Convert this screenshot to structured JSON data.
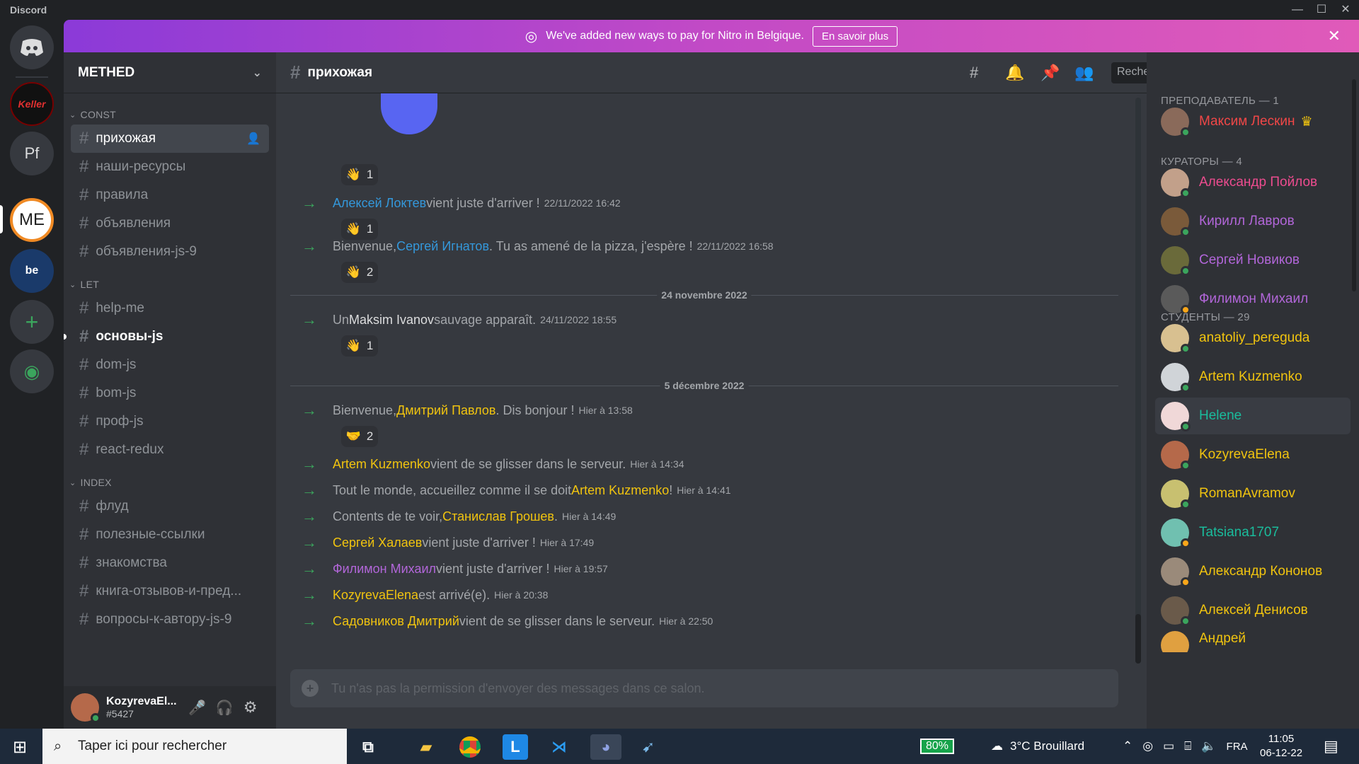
{
  "titlebar": {
    "app": "Discord",
    "min": "—",
    "max": "☐",
    "close": "✕"
  },
  "guilds": [
    {
      "name": "discord-home",
      "label": "",
      "color": "#36393f"
    },
    {
      "name": "keller",
      "label": "Keller",
      "color": "#111111"
    },
    {
      "name": "pf",
      "label": "Pf",
      "color": "#36393f"
    },
    {
      "name": "me",
      "label": "ME",
      "color": "#ffffff"
    },
    {
      "name": "be-charleroi",
      "label": "be",
      "color": "#1a3a6a"
    }
  ],
  "banner": {
    "text": "We've added new ways to pay for Nitro in Belgique.",
    "button": "En savoir plus"
  },
  "server": {
    "name": "METHED"
  },
  "categories": [
    {
      "name": "CONST",
      "channels": [
        "прихожая",
        "наши-ресурсы",
        "правила",
        "объявления",
        "объявления-js-9"
      ]
    },
    {
      "name": "LET",
      "channels": [
        "help-me",
        "основы-js",
        "dom-js",
        "bom-js",
        "проф-js",
        "react-redux"
      ]
    },
    {
      "name": "INDEX",
      "channels": [
        "флуд",
        "полезные-ссылки",
        "знакомства",
        "книга-отзывов-и-пред...",
        "вопросы-к-автору-js-9"
      ]
    }
  ],
  "user": {
    "name": "KozyrevaEl...",
    "tag": "#5427"
  },
  "channel": {
    "title": "прихожая"
  },
  "search": {
    "placeholder": "Rechercher"
  },
  "messages": {
    "m1": {
      "pre": "",
      "name": "Алексей Локтев",
      "post": " vient juste d'arriver !",
      "ts": "22/11/2022 16:42",
      "reaction": "1"
    },
    "m2": {
      "pre": "Bienvenue, ",
      "name": "Сергей Игнатов",
      "post": ". Tu as amené de la pizza, j'espère !",
      "ts": "22/11/2022 16:58",
      "reaction": "2"
    },
    "d1": "24 novembre 2022",
    "m3": {
      "pre": "Un ",
      "name": "Maksim Ivanov",
      "post": " sauvage apparaît.",
      "ts": "24/11/2022 18:55",
      "reaction": "1"
    },
    "d2": "5 décembre 2022",
    "m4": {
      "pre": "Bienvenue, ",
      "name": "Дмитрий Павлов",
      "post": ". Dis bonjour !",
      "ts": "Hier à 13:58",
      "reaction": "2"
    },
    "m5": {
      "pre": "",
      "name": "Artem Kuzmenko",
      "post": " vient de se glisser dans le serveur.",
      "ts": "Hier à 14:34"
    },
    "m6": {
      "pre": "Tout le monde, accueillez comme il se doit ",
      "name": "Artem Kuzmenko",
      "post": " !",
      "ts": "Hier à 14:41"
    },
    "m7": {
      "pre": "Contents de te voir, ",
      "name": "Станислав Грошев",
      "post": ".",
      "ts": "Hier à 14:49"
    },
    "m8": {
      "pre": "",
      "name": "Сергей Халаев",
      "post": " vient juste d'arriver !",
      "ts": "Hier à 17:49"
    },
    "m9": {
      "pre": "",
      "name": "Филимон Михаил",
      "post": " vient juste d'arriver !",
      "ts": "Hier à 19:57"
    },
    "m10": {
      "pre": "",
      "name": "KozyrevaElena",
      "post": " est arrivé(e).",
      "ts": "Hier à 20:38"
    },
    "m11": {
      "pre": "",
      "name": "Садовников Дмитрий",
      "post": " vient de se glisser dans le serveur.",
      "ts": "Hier à 22:50"
    },
    "top_reaction": "1"
  },
  "compose": {
    "placeholder": "Tu n'as pas la permission d'envoyer des messages dans ce salon."
  },
  "members": {
    "g1": "ПРЕПОДАВАТЕЛЬ — 1",
    "g1m": [
      "Максим Лескин"
    ],
    "g2": "КУРАТОРЫ — 4",
    "g2m": [
      "Александр Пойлов",
      "Кирилл Лавров",
      "Сергей Новиков",
      "Филимон Михаил"
    ],
    "g3": "СТУДЕНТЫ — 29",
    "g3m": [
      "anatoliy_pereguda",
      "Artem Kuzmenko",
      "Helene",
      "KozyrevaElena",
      "RomanAvramov",
      "Tatsiana1707",
      "Александр Кононов",
      "Алексей Денисов",
      "Андрей"
    ]
  },
  "colors": {
    "teacher": "#f04747",
    "curator": "#ed4c8f",
    "purple": "#b266d9",
    "yellow": "#f1c40f",
    "teal": "#1abc9c",
    "blue": "#3498db"
  },
  "taskbar": {
    "search": "Taper ici pour rechercher",
    "battery": "80%",
    "weather": "3°C  Brouillard",
    "lang": "FRA",
    "time": "11:05",
    "date": "06-12-22"
  }
}
